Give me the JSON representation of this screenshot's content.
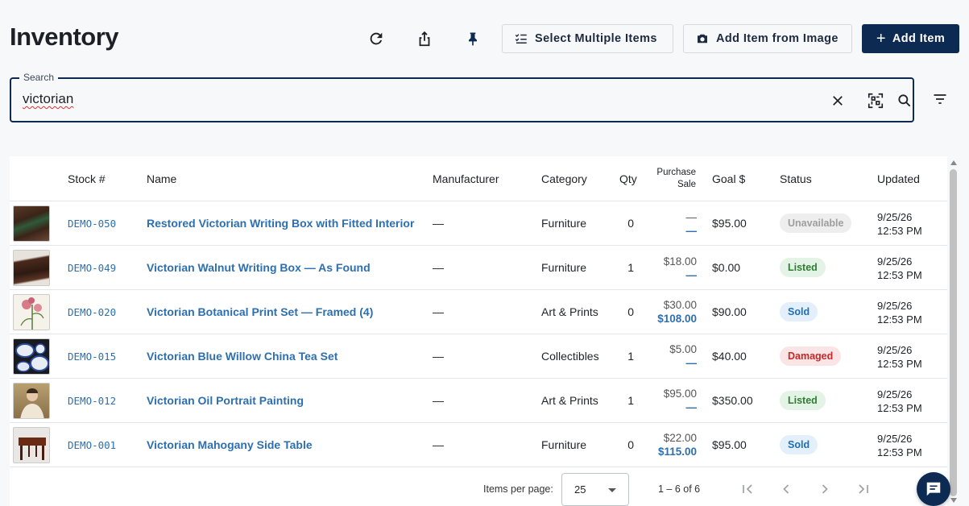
{
  "header": {
    "title": "Inventory",
    "select_multiple_label": "Select Multiple Items",
    "add_from_image_label": "Add Item from Image",
    "add_item_label": "Add Item",
    "icons": [
      "refresh-icon",
      "share-icon",
      "pin-icon"
    ]
  },
  "search": {
    "legend": "Search",
    "value": "victorian",
    "icons": [
      "clear-icon",
      "qr-scan-icon",
      "search-icon",
      "filter-icon"
    ]
  },
  "table": {
    "columns": {
      "stock": "Stock #",
      "name": "Name",
      "manufacturer": "Manufacturer",
      "category": "Category",
      "qty": "Qty",
      "purchase": "Purchase",
      "sale": "Sale",
      "goal": "Goal $",
      "status": "Status",
      "updated": "Updated"
    },
    "rows": [
      {
        "stock": "DEMO-050",
        "name": "Restored Victorian Writing Box with Fitted Interior",
        "manufacturer": "—",
        "category": "Furniture",
        "qty": "0",
        "purchase": "—",
        "sale": "—",
        "goal": "$95.00",
        "status": "Unavailable",
        "updated_date": "9/25/26",
        "updated_time": "12:53 PM"
      },
      {
        "stock": "DEMO-049",
        "name": "Victorian Walnut Writing Box — As Found",
        "manufacturer": "—",
        "category": "Furniture",
        "qty": "1",
        "purchase": "$18.00",
        "sale": "—",
        "goal": "$0.00",
        "status": "Listed",
        "updated_date": "9/25/26",
        "updated_time": "12:53 PM"
      },
      {
        "stock": "DEMO-020",
        "name": "Victorian Botanical Print Set — Framed (4)",
        "manufacturer": "—",
        "category": "Art & Prints",
        "qty": "0",
        "purchase": "$30.00",
        "sale": "$108.00",
        "goal": "$90.00",
        "status": "Sold",
        "updated_date": "9/25/26",
        "updated_time": "12:53 PM"
      },
      {
        "stock": "DEMO-015",
        "name": "Victorian Blue Willow China Tea Set",
        "manufacturer": "—",
        "category": "Collectibles",
        "qty": "1",
        "purchase": "$5.00",
        "sale": "—",
        "goal": "$40.00",
        "status": "Damaged",
        "updated_date": "9/25/26",
        "updated_time": "12:53 PM"
      },
      {
        "stock": "DEMO-012",
        "name": "Victorian Oil Portrait Painting",
        "manufacturer": "—",
        "category": "Art & Prints",
        "qty": "1",
        "purchase": "$95.00",
        "sale": "—",
        "goal": "$350.00",
        "status": "Listed",
        "updated_date": "9/25/26",
        "updated_time": "12:53 PM"
      },
      {
        "stock": "DEMO-001",
        "name": "Victorian Mahogany Side Table",
        "manufacturer": "—",
        "category": "Furniture",
        "qty": "0",
        "purchase": "$22.00",
        "sale": "$115.00",
        "goal": "$95.00",
        "status": "Sold",
        "updated_date": "9/25/26",
        "updated_time": "12:53 PM"
      }
    ]
  },
  "status_colors": {
    "Unavailable": {
      "bg": "#eeeeee",
      "fg": "#9e9e9e"
    },
    "Listed": {
      "bg": "#e3f3e5",
      "fg": "#2e7d32"
    },
    "Sold": {
      "bg": "#e3effa",
      "fg": "#1f6fb5"
    },
    "Damaged": {
      "bg": "#fbe4e6",
      "fg": "#c62828"
    }
  },
  "pagination": {
    "items_per_page_label": "Items per page:",
    "items_per_page": "25",
    "range": "1 – 6 of 6"
  },
  "colors": {
    "primary": "#0d2a52",
    "link": "#2d6fb0"
  }
}
